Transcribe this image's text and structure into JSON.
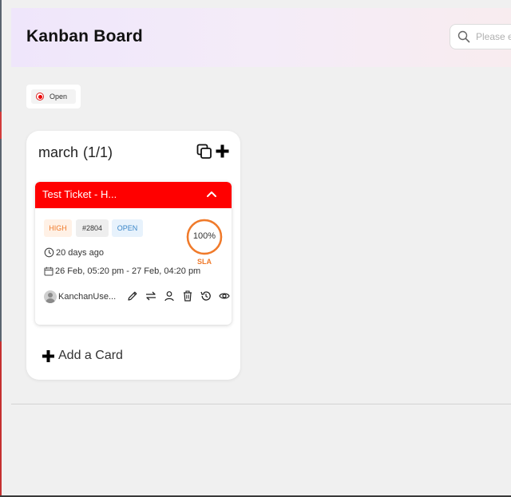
{
  "header": {
    "title": "Kanban Board",
    "search_placeholder": "Please enter"
  },
  "filters": [
    {
      "label": "Open",
      "selected": true,
      "color": "#e00000"
    }
  ],
  "columns": [
    {
      "name": "march",
      "count": "(1/1)",
      "add_card_label": "Add a Card",
      "cards": [
        {
          "title": "Test Ticket - H...",
          "header_color": "#ff0000",
          "priority": "HIGH",
          "ticket_id": "#2804",
          "status": "OPEN",
          "age": "20 days ago",
          "date_range": "26 Feb, 05:20 pm - 27 Feb, 04:20 pm",
          "assignee": "KanchanUse...",
          "sla_percent": "100%",
          "sla_value": 100,
          "sla_label": "SLA",
          "sla_color": "#f07a2a",
          "actions": [
            "edit-icon",
            "transfer-icon",
            "assign-user-icon",
            "delete-icon",
            "history-icon",
            "view-icon"
          ]
        }
      ]
    }
  ]
}
